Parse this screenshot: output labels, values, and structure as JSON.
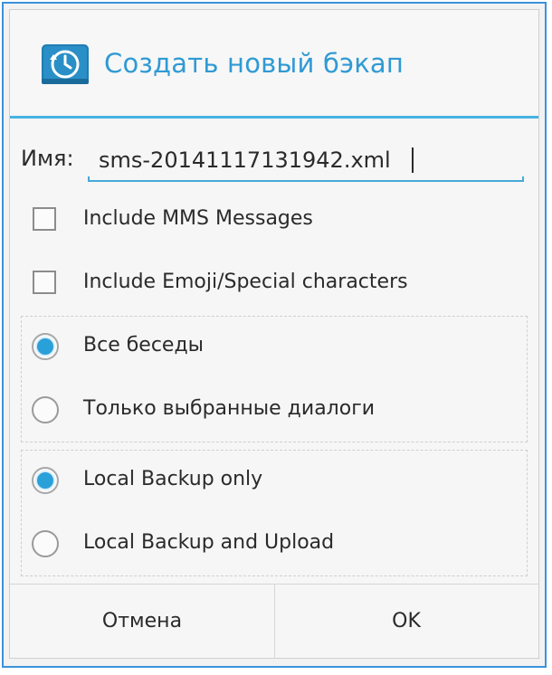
{
  "dialog": {
    "title": "Создать новый бэкап",
    "icon": "backup-clock-icon",
    "accent_color": "#2f9ad3",
    "divider_color": "#48b2e2"
  },
  "name_field": {
    "label": "Имя:",
    "value": "sms-20141117131942.xml"
  },
  "checkboxes": [
    {
      "label": "Include MMS Messages",
      "checked": false
    },
    {
      "label": "Include Emoji/Special characters",
      "checked": false
    }
  ],
  "conversation_scope": [
    {
      "label": "Все беседы",
      "selected": true
    },
    {
      "label": "Только выбранные диалоги",
      "selected": false
    }
  ],
  "backup_location": [
    {
      "label": "Local Backup only",
      "selected": true
    },
    {
      "label": "Local Backup and Upload",
      "selected": false
    }
  ],
  "buttons": {
    "cancel_label": "Отмена",
    "ok_label": "OK"
  }
}
